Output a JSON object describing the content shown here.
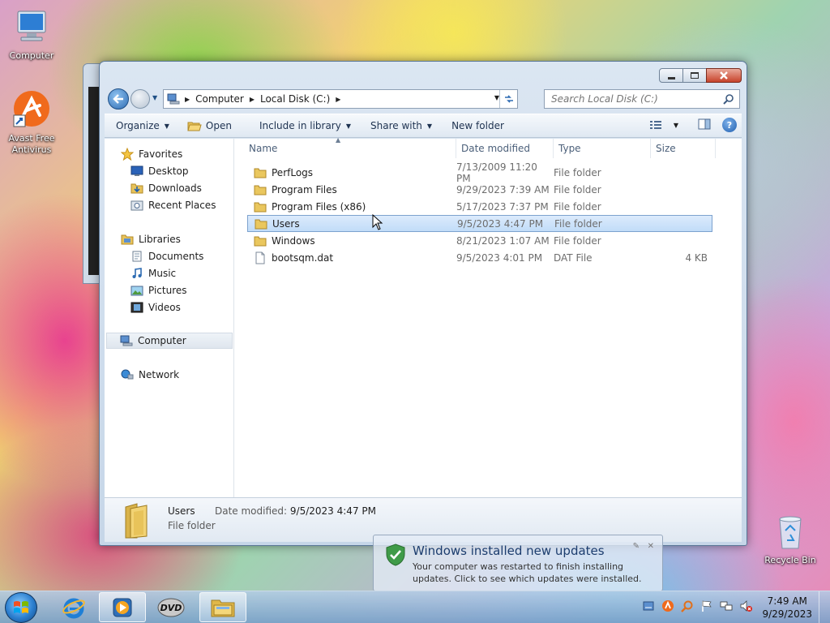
{
  "desktop": {
    "icons": [
      {
        "label": "Computer"
      },
      {
        "label": "Avast Free Antivirus"
      },
      {
        "label": "Recycle Bin"
      }
    ]
  },
  "address_bar": {
    "crumbs": [
      "Computer",
      "Local Disk (C:)"
    ]
  },
  "search": {
    "placeholder": "Search Local Disk (C:)"
  },
  "command_bar": {
    "organize": "Organize",
    "open": "Open",
    "include_in_library": "Include in library",
    "share_with": "Share with",
    "new_folder": "New folder"
  },
  "nav_pane": {
    "favorites": "Favorites",
    "desktop": "Desktop",
    "downloads": "Downloads",
    "recent_places": "Recent Places",
    "libraries": "Libraries",
    "documents": "Documents",
    "music": "Music",
    "pictures": "Pictures",
    "videos": "Videos",
    "computer": "Computer",
    "network": "Network"
  },
  "file_list": {
    "columns": [
      "Name",
      "Date modified",
      "Type",
      "Size"
    ],
    "rows": [
      {
        "name": "PerfLogs",
        "date": "7/13/2009 11:20 PM",
        "type": "File folder",
        "size": "",
        "kind": "folder"
      },
      {
        "name": "Program Files",
        "date": "9/29/2023 7:39 AM",
        "type": "File folder",
        "size": "",
        "kind": "folder"
      },
      {
        "name": "Program Files (x86)",
        "date": "5/17/2023 7:37 PM",
        "type": "File folder",
        "size": "",
        "kind": "folder"
      },
      {
        "name": "Users",
        "date": "9/5/2023 4:47 PM",
        "type": "File folder",
        "size": "",
        "kind": "folder"
      },
      {
        "name": "Windows",
        "date": "8/21/2023 1:07 AM",
        "type": "File folder",
        "size": "",
        "kind": "folder"
      },
      {
        "name": "bootsqm.dat",
        "date": "9/5/2023 4:01 PM",
        "type": "DAT File",
        "size": "4 KB",
        "kind": "file"
      }
    ]
  },
  "details_pane": {
    "name": "Users",
    "modified_label": "Date modified:",
    "modified_value": "9/5/2023 4:47 PM",
    "type": "File folder"
  },
  "notification": {
    "title": "Windows installed new updates",
    "body": "Your computer was restarted to finish installing updates. Click to see which updates were installed."
  },
  "taskbar": {
    "time": "7:49 AM",
    "date": "9/29/2023"
  }
}
